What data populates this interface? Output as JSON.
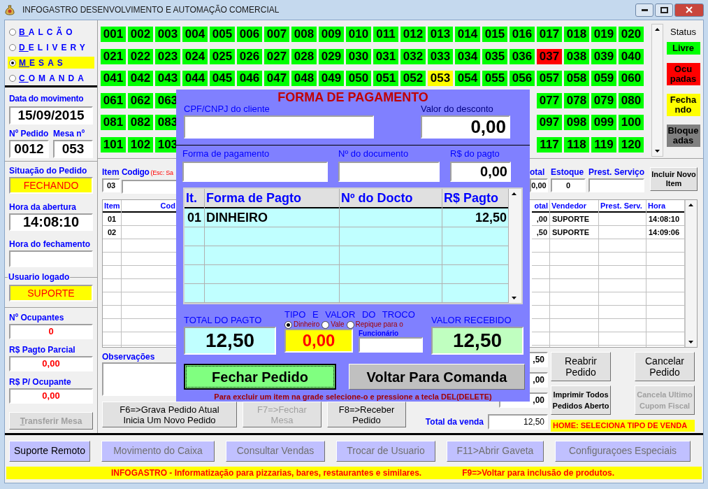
{
  "window": {
    "title": "INFOGASTRO DESENVOLVIMENTO E AUTOMAÇÃO COMERCIAL"
  },
  "sale_types": [
    {
      "label": "BALCÃO",
      "selected": false
    },
    {
      "label": "DELIVERY",
      "selected": false
    },
    {
      "label": "MESAS",
      "selected": true
    },
    {
      "label": "COMANDA",
      "selected": false
    }
  ],
  "left_panel": {
    "movement_date": {
      "label": "Data do movimento",
      "value": "15/09/2015"
    },
    "order": [
      {
        "label": "Nº Pedido",
        "value": "0012"
      },
      {
        "label": "Mesa nº",
        "value": "053"
      }
    ],
    "order_status": {
      "label": "Situação do Pedido",
      "value": "FECHANDO"
    },
    "opened_at": {
      "label": "Hora da abertura",
      "value": "14:08:10"
    },
    "closed_at": {
      "label": "Hora do fechamento"
    },
    "logged_user": {
      "label": "Usuario logado",
      "value": "SUPORTE"
    },
    "occupants": {
      "label": "Nº Ocupantes",
      "value": "0"
    },
    "partial_payment": {
      "label": "R$ Pagto Parcial",
      "value": "0,00"
    },
    "per_occupant": {
      "label": "R$ P/ Ocupante",
      "value": "0,00"
    },
    "transfer_button": {
      "label": "Transferir Mesa",
      "disabled": true
    }
  },
  "tables": [
    {
      "left": [
        {
          "number": "001",
          "color": "#00ff00"
        },
        {
          "number": "002",
          "color": "#00ff00"
        },
        {
          "number": "003",
          "color": "#00ff00"
        },
        {
          "number": "004",
          "color": "#00ff00"
        },
        {
          "number": "005",
          "color": "#00ff00"
        },
        {
          "number": "006",
          "color": "#00ff00"
        },
        {
          "number": "007",
          "color": "#00ff00"
        },
        {
          "number": "008",
          "color": "#00ff00"
        },
        {
          "number": "009",
          "color": "#00ff00"
        },
        {
          "number": "010",
          "color": "#00ff00"
        },
        {
          "number": "011",
          "color": "#00ff00"
        },
        {
          "number": "012",
          "color": "#00ff00"
        },
        {
          "number": "013",
          "color": "#00ff00"
        },
        {
          "number": "014",
          "color": "#00ff00"
        },
        {
          "number": "015",
          "color": "#00ff00"
        },
        {
          "number": "016",
          "color": "#00ff00"
        },
        {
          "number": "017",
          "color": "#00ff00"
        },
        {
          "number": "018",
          "color": "#00ff00"
        },
        {
          "number": "019",
          "color": "#00ff00"
        },
        {
          "number": "020",
          "color": "#00ff00"
        }
      ]
    },
    {
      "left": [
        {
          "number": "021",
          "color": "#00ff00"
        },
        {
          "number": "022",
          "color": "#00ff00"
        },
        {
          "number": "023",
          "color": "#00ff00"
        },
        {
          "number": "024",
          "color": "#00ff00"
        },
        {
          "number": "025",
          "color": "#00ff00"
        },
        {
          "number": "026",
          "color": "#00ff00"
        },
        {
          "number": "027",
          "color": "#00ff00"
        },
        {
          "number": "028",
          "color": "#00ff00"
        },
        {
          "number": "029",
          "color": "#00ff00"
        },
        {
          "number": "030",
          "color": "#00ff00"
        },
        {
          "number": "031",
          "color": "#00ff00"
        },
        {
          "number": "032",
          "color": "#00ff00"
        },
        {
          "number": "033",
          "color": "#00ff00"
        },
        {
          "number": "034",
          "color": "#00ff00"
        },
        {
          "number": "035",
          "color": "#00ff00"
        },
        {
          "number": "036",
          "color": "#00ff00"
        },
        {
          "number": "037",
          "color": "#ff0000"
        },
        {
          "number": "038",
          "color": "#00ff00"
        },
        {
          "number": "039",
          "color": "#00ff00"
        },
        {
          "number": "040",
          "color": "#00ff00"
        }
      ]
    },
    {
      "left": [
        {
          "number": "041",
          "color": "#00ff00"
        },
        {
          "number": "042",
          "color": "#00ff00"
        },
        {
          "number": "043",
          "color": "#00ff00"
        },
        {
          "number": "044",
          "color": "#00ff00"
        },
        {
          "number": "045",
          "color": "#00ff00"
        },
        {
          "number": "046",
          "color": "#00ff00"
        },
        {
          "number": "047",
          "color": "#00ff00"
        },
        {
          "number": "048",
          "color": "#00ff00"
        },
        {
          "number": "049",
          "color": "#00ff00"
        },
        {
          "number": "050",
          "color": "#00ff00"
        },
        {
          "number": "051",
          "color": "#00ff00"
        },
        {
          "number": "052",
          "color": "#00ff00"
        },
        {
          "number": "053",
          "color": "#ffff00"
        },
        {
          "number": "054",
          "color": "#00ff00"
        },
        {
          "number": "055",
          "color": "#00ff00"
        },
        {
          "number": "056",
          "color": "#00ff00"
        },
        {
          "number": "057",
          "color": "#00ff00"
        },
        {
          "number": "058",
          "color": "#00ff00"
        },
        {
          "number": "059",
          "color": "#00ff00"
        },
        {
          "number": "060",
          "color": "#00ff00"
        }
      ]
    },
    {
      "left": [
        {
          "number": "061",
          "color": "#00ff00"
        },
        {
          "number": "062",
          "color": "#00ff00"
        },
        {
          "number": "063",
          "color": "#00ff00"
        }
      ],
      "right": [
        {
          "number": "077",
          "color": "#00ff00"
        },
        {
          "number": "078",
          "color": "#00ff00"
        },
        {
          "number": "079",
          "color": "#00ff00"
        },
        {
          "number": "080",
          "color": "#00ff00"
        }
      ]
    },
    {
      "left": [
        {
          "number": "081",
          "color": "#00ff00"
        },
        {
          "number": "082",
          "color": "#00ff00"
        },
        {
          "number": "083",
          "color": "#00ff00"
        }
      ],
      "right": [
        {
          "number": "097",
          "color": "#00ff00"
        },
        {
          "number": "098",
          "color": "#00ff00"
        },
        {
          "number": "099",
          "color": "#00ff00"
        },
        {
          "number": "100",
          "color": "#00ff00"
        }
      ]
    },
    {
      "left": [
        {
          "number": "101",
          "color": "#00ff00"
        },
        {
          "number": "102",
          "color": "#00ff00"
        },
        {
          "number": "103",
          "color": "#00ff00"
        }
      ],
      "right": [
        {
          "number": "117",
          "color": "#00ff00"
        },
        {
          "number": "118",
          "color": "#00ff00"
        },
        {
          "number": "119",
          "color": "#00ff00"
        },
        {
          "number": "120",
          "color": "#00ff00"
        }
      ]
    }
  ],
  "status_legend": {
    "title": "Status",
    "items": [
      {
        "lines": [
          "Livre"
        ],
        "color": "#00ff00"
      },
      {
        "lines": [
          "Ocu",
          "padas"
        ],
        "color": "#ff0000"
      },
      {
        "lines": [
          "Fecha",
          "ndo"
        ],
        "color": "#ffff00"
      },
      {
        "lines": [
          "Bloque",
          "adas"
        ],
        "color": "#808080"
      }
    ]
  },
  "item_entry": {
    "item_label": "Item",
    "item_value": "03",
    "code_label": "Codigo",
    "code_hint": "(Esc: Sa",
    "total_label": "otal",
    "total_value": "0,00",
    "stock_label": "Estoque",
    "stock_value": "0",
    "service_label": "Prest. Serviço",
    "add_button": "Incluir Novo Item"
  },
  "items_grid": {
    "left_columns": [
      "Item",
      "Cod"
    ],
    "right_columns": [
      "otal",
      "Vendedor",
      "Prest. Serv.",
      "Hora"
    ],
    "rows": [
      {
        "item": "01",
        "total": ",00",
        "seller": "SUPORTE",
        "time": "14:08:10"
      },
      {
        "item": "02",
        "total": ",50",
        "seller": "SUPORTE",
        "time": "14:09:06"
      }
    ]
  },
  "observations_label": "Observações",
  "order_buttons": [
    {
      "lines": [
        "F6=>Grava Pedido Atual",
        "Inicia Um Novo Pedido"
      ],
      "disabled": false
    },
    {
      "lines": [
        "F7=>Fechar",
        "Mesa"
      ],
      "disabled": true
    },
    {
      "lines": [
        "F8=>Receber",
        "Pedido"
      ],
      "disabled": false
    }
  ],
  "summary_fields": [
    ",50",
    ",00",
    ",00"
  ],
  "sale_total": {
    "label": "Total da venda",
    "value": "12,50"
  },
  "side_buttons": [
    {
      "label": "Reabrir Pedido",
      "disabled": false
    },
    {
      "label": "Cancelar Pedido",
      "disabled": false
    },
    {
      "label": "Imprimir Todos Pedidos Aberto",
      "disabled": false
    },
    {
      "label": "Cancela Ultimo Cupom Fiscal",
      "disabled": true
    }
  ],
  "home_hint": "HOME: SELECIONA TIPO DE VENDA",
  "footer_buttons": [
    {
      "label": "Suporte Remoto",
      "disabled": false
    },
    {
      "label": "Movimento do Caixa",
      "disabled": true
    },
    {
      "label": "Consultar Vendas",
      "disabled": true
    },
    {
      "label": "Trocar de Usuario",
      "disabled": true
    },
    {
      "label": "F11>Abrir Gaveta",
      "disabled": true
    },
    {
      "label": "Configuraçoes Especiais",
      "disabled": true
    }
  ],
  "status_bar": [
    "INFOGASTRO - Informatização para pizzarias, bares, restaurantes e similares.",
    "F9=>Voltar para inclusão de produtos."
  ],
  "payment_dialog": {
    "title": "FORMA DE PAGAMENTO",
    "cpf_label": "CPF/CNPJ do cliente",
    "discount_label": "Valor do desconto",
    "discount_value": "0,00",
    "method_label": "Forma de pagamento",
    "document_label": "Nº do documento",
    "amount_label": "R$ do pagto",
    "amount_value": "0,00",
    "columns": [
      "It.",
      "Forma de Pagto",
      "Nº do Docto",
      "R$ Pagto"
    ],
    "payments": [
      {
        "item": "01",
        "method": "DINHEIRO",
        "amount": "12,50"
      }
    ],
    "total_label": "TOTAL DO PAGTO",
    "total_value": "12,50",
    "change_label": "TIPO E VALOR DO TROCO",
    "change_types": [
      {
        "label": "Dinheiro",
        "selected": true
      },
      {
        "label": "Vale",
        "selected": false
      },
      {
        "label": "Repique para o",
        "selected": false
      }
    ],
    "change_value": "0,00",
    "employee_label": "Funcionário",
    "received_label": "VALOR RECEBIDO",
    "received_value": "12,50",
    "buttons": [
      {
        "label": "Fechar Pedido",
        "kind": "primary"
      },
      {
        "label": "Voltar Para Comanda",
        "kind": "secondary"
      }
    ],
    "hint": "Para excluir um item na grade selecione-o e pressione a tecla DEL(DELETE)"
  }
}
